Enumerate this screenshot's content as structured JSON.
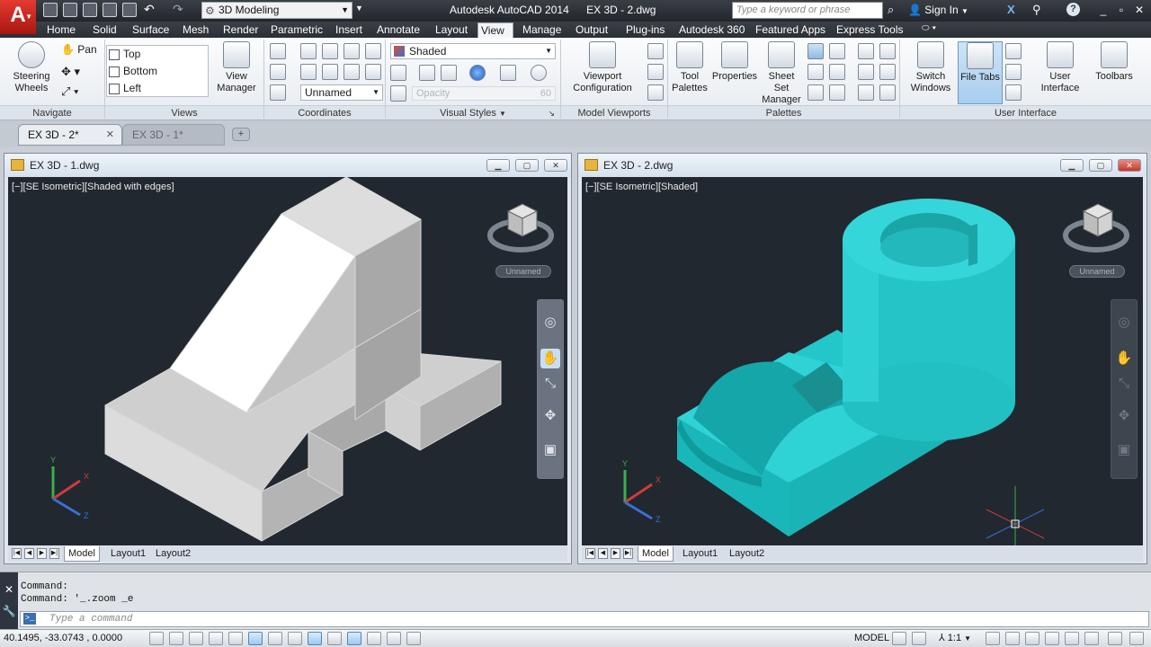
{
  "app": {
    "logo_text": "A",
    "product": "Autodesk AutoCAD 2014",
    "file": "EX 3D - 2.dwg",
    "workspace": "3D Modeling",
    "search_placeholder": "Type a keyword or phrase",
    "sign_in": "Sign In"
  },
  "ribbon_tabs": [
    "Home",
    "Solid",
    "Surface",
    "Mesh",
    "Render",
    "Parametric",
    "Insert",
    "Annotate",
    "Layout",
    "View",
    "Manage",
    "Output",
    "Plug-ins",
    "Autodesk 360",
    "Featured Apps",
    "Express Tools"
  ],
  "active_tab": "View",
  "panels": {
    "navigate": {
      "label": "Navigate",
      "steering_wheels": "Steering Wheels",
      "steering_wheels_l1": "Steering",
      "steering_wheels_l2": "Wheels",
      "pan": "Pan"
    },
    "views": {
      "label": "Views",
      "items": [
        "Top",
        "Bottom",
        "Left"
      ],
      "view_manager_l1": "View",
      "view_manager_l2": "Manager"
    },
    "coordinates": {
      "label": "Coordinates",
      "ucs_name": "Unnamed"
    },
    "visual_styles": {
      "label": "Visual Styles",
      "style": "Shaded",
      "opacity_label": "Opacity",
      "opacity_value": "60"
    },
    "model_viewports": {
      "label": "Model Viewports",
      "config_l1": "Viewport",
      "config_l2": "Configuration"
    },
    "palettes": {
      "label": "Palettes",
      "tool_palettes_l1": "Tool",
      "tool_palettes_l2": "Palettes",
      "properties": "Properties",
      "sheet_set_l1": "Sheet Set",
      "sheet_set_l2": "Manager"
    },
    "user_interface": {
      "label": "User Interface",
      "switch_windows_l1": "Switch",
      "switch_windows_l2": "Windows",
      "file_tabs": "File Tabs",
      "user_interface_l1": "User",
      "user_interface_l2": "Interface",
      "toolbars": "Toolbars"
    }
  },
  "doc_tabs": [
    {
      "name": "EX 3D - 2*",
      "active": true
    },
    {
      "name": "EX 3D - 1*",
      "active": false
    }
  ],
  "windows": [
    {
      "title": "EX 3D - 1.dwg",
      "viewport_label": "[−][SE Isometric][Shaded with edges]",
      "named_view": "Unnamed",
      "layouts": [
        "Model",
        "Layout1",
        "Layout2"
      ]
    },
    {
      "title": "EX 3D - 2.dwg",
      "viewport_label": "[−][SE Isometric][Shaded]",
      "named_view": "Unnamed",
      "layouts": [
        "Model",
        "Layout1",
        "Layout2"
      ]
    }
  ],
  "command": {
    "history": [
      "Command:",
      "Command: '_.zoom _e"
    ],
    "placeholder": "Type a command"
  },
  "status": {
    "coordinates": "40.1495, -33.0743 , 0.0000",
    "space": "MODEL",
    "scale": "1:1"
  },
  "colors": {
    "drawing_bg": "#212830",
    "shaded_model": "#1fc4c7",
    "edges_model": "#cfcfcf",
    "logo": "#d42a20"
  }
}
